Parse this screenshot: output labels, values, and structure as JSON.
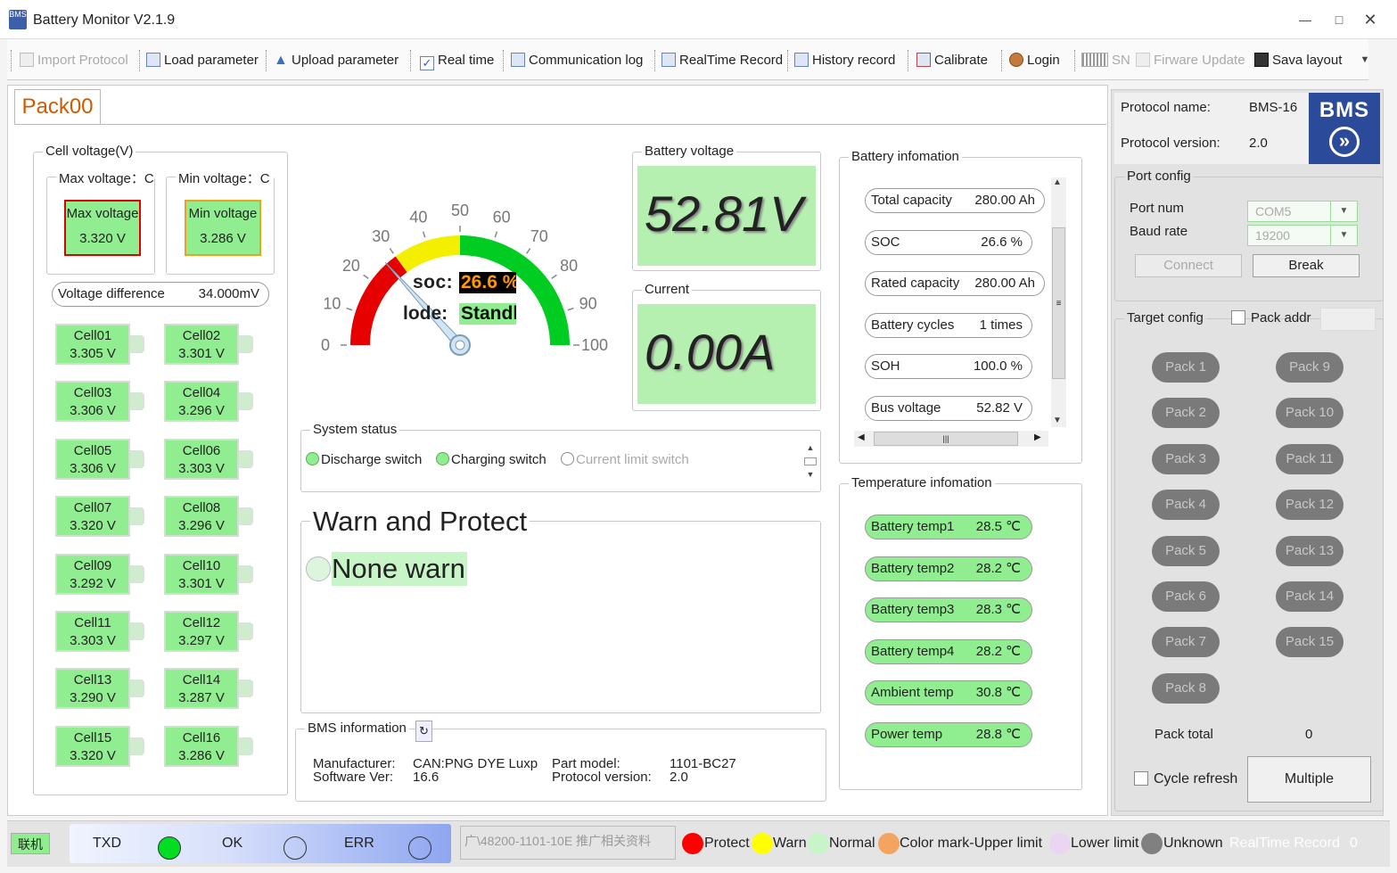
{
  "app": {
    "title": "Battery Monitor V2.1.9",
    "icon_text": "BMS",
    "minimize_icon": "minimize-icon",
    "maximize_icon": "maximize-icon",
    "close_icon": "close-icon"
  },
  "toolbar": {
    "import_protocol": "Import Protocol",
    "load_parameter": "Load parameter",
    "upload_parameter": "Upload parameter",
    "real_time": "Real time",
    "communication_log": "Communication log",
    "realtime_record": "RealTime Record",
    "history_record": "History record",
    "calibrate": "Calibrate",
    "login": "Login",
    "sn": "SN",
    "firmware_update": "Firware Update",
    "save_layout": "Sava layout"
  },
  "tab": {
    "label": "Pack00"
  },
  "cell_voltage": {
    "title": "Cell voltage(V)",
    "max_label": "Max voltage：",
    "max_trunc": "C",
    "min_label": "Min voltage：",
    "min_trunc": "C",
    "max_box_label": "Max voltage",
    "max_box_value": "3.320 V",
    "min_box_label": "Min voltage",
    "min_box_value": "3.286 V",
    "diff_label": "Voltage difference",
    "diff_value": "34.000mV",
    "cells": [
      {
        "name": "Cell01",
        "value": "3.305 V"
      },
      {
        "name": "Cell02",
        "value": "3.301 V"
      },
      {
        "name": "Cell03",
        "value": "3.306 V"
      },
      {
        "name": "Cell04",
        "value": "3.296 V"
      },
      {
        "name": "Cell05",
        "value": "3.306 V"
      },
      {
        "name": "Cell06",
        "value": "3.303 V"
      },
      {
        "name": "Cell07",
        "value": "3.320 V"
      },
      {
        "name": "Cell08",
        "value": "3.296 V"
      },
      {
        "name": "Cell09",
        "value": "3.292 V"
      },
      {
        "name": "Cell10",
        "value": "3.301 V"
      },
      {
        "name": "Cell11",
        "value": "3.303 V"
      },
      {
        "name": "Cell12",
        "value": "3.297 V"
      },
      {
        "name": "Cell13",
        "value": "3.290 V"
      },
      {
        "name": "Cell14",
        "value": "3.287 V"
      },
      {
        "name": "Cell15",
        "value": "3.320 V"
      },
      {
        "name": "Cell16",
        "value": "3.286 V"
      }
    ]
  },
  "gauge": {
    "ticks": [
      "0",
      "10",
      "20",
      "30",
      "40",
      "50",
      "60",
      "70",
      "80",
      "90",
      "100"
    ],
    "soc_label": "soc:",
    "soc_value": "26.6 %",
    "mode_label": "lode:",
    "mode_value": "Standl",
    "needle_value": 26.6,
    "colors": {
      "red": "#e60000",
      "yellow": "#f4ef00",
      "green": "#00cc22"
    }
  },
  "battery_voltage": {
    "title": "Battery voltage",
    "value": "52.81V"
  },
  "current": {
    "title": "Current",
    "value": "0.00A"
  },
  "battery_info": {
    "title": "Battery infomation",
    "items": [
      {
        "label": "Total capacity",
        "value": "280.00 Ah"
      },
      {
        "label": "SOC",
        "value": "26.6 %"
      },
      {
        "label": "Rated capacity",
        "value": "280.00 Ah"
      },
      {
        "label": "Battery cycles",
        "value": "1 times"
      },
      {
        "label": "SOH",
        "value": "100.0 %"
      },
      {
        "label": "Bus voltage",
        "value": "52.82 V"
      }
    ]
  },
  "system_status": {
    "title": "System status",
    "discharge": "Discharge switch",
    "charging": "Charging switch",
    "current_limit": "Current limit switch"
  },
  "warn": {
    "title": "Warn and Protect",
    "status": "None warn"
  },
  "temperature": {
    "title": "Temperature infomation",
    "items": [
      {
        "label": "Battery temp1",
        "value": "28.5 ℃"
      },
      {
        "label": "Battery temp2",
        "value": "28.2 ℃"
      },
      {
        "label": "Battery temp3",
        "value": "28.3 ℃"
      },
      {
        "label": "Battery temp4",
        "value": "28.2 ℃"
      },
      {
        "label": "Ambient temp",
        "value": "30.8 ℃"
      },
      {
        "label": "Power temp",
        "value": "28.8 ℃"
      }
    ]
  },
  "bms_info": {
    "title": "BMS information",
    "manufacturer_label": "Manufacturer:",
    "manufacturer_value": "CAN:PNG  DYE  Luxp",
    "software_label": "Software Ver:",
    "software_value": "16.6",
    "part_label": "Part model:",
    "part_value": "1101-BC27",
    "protocol_label": "Protocol version:",
    "protocol_value": "2.0"
  },
  "protocol": {
    "name_label": "Protocol name:",
    "name_value": "BMS-16",
    "version_label": "Protocol version:",
    "version_value": "2.0",
    "logo": "BMS"
  },
  "port_config": {
    "title": "Port config",
    "port_label": "Port num",
    "port_value": "COM5",
    "baud_label": "Baud rate",
    "baud_value": "19200",
    "connect": "Connect",
    "break": "Break"
  },
  "target_config": {
    "title": "Target config",
    "pack_addr_label": "Pack addr",
    "packs": [
      "Pack 1",
      "Pack 2",
      "Pack 3",
      "Pack 4",
      "Pack 5",
      "Pack 6",
      "Pack 7",
      "Pack 8",
      "Pack 9",
      "Pack 10",
      "Pack 11",
      "Pack 12",
      "Pack 13",
      "Pack 14",
      "Pack 15"
    ],
    "pack_total_label": "Pack total",
    "pack_total_value": "0",
    "cycle_refresh": "Cycle refresh",
    "multiple": "Multiple"
  },
  "statusbar": {
    "link": "联机",
    "txd": "TXD",
    "ok": "OK",
    "err": "ERR",
    "file": "广\\48200-1101-10E 推广相关资料",
    "legend": [
      {
        "label": "Protect",
        "color": "#ff0000"
      },
      {
        "label": "Warn",
        "color": "#ffff00"
      },
      {
        "label": "Normal",
        "color": "#c8f5c8"
      },
      {
        "label": "Color mark-Upper limit",
        "color": "#f4a460"
      },
      {
        "label": "Lower limit",
        "color": "#ead6f2"
      },
      {
        "label": "Unknown",
        "color": "#808080"
      }
    ],
    "realtime_record": "RealTime Record",
    "record_count": "0"
  }
}
